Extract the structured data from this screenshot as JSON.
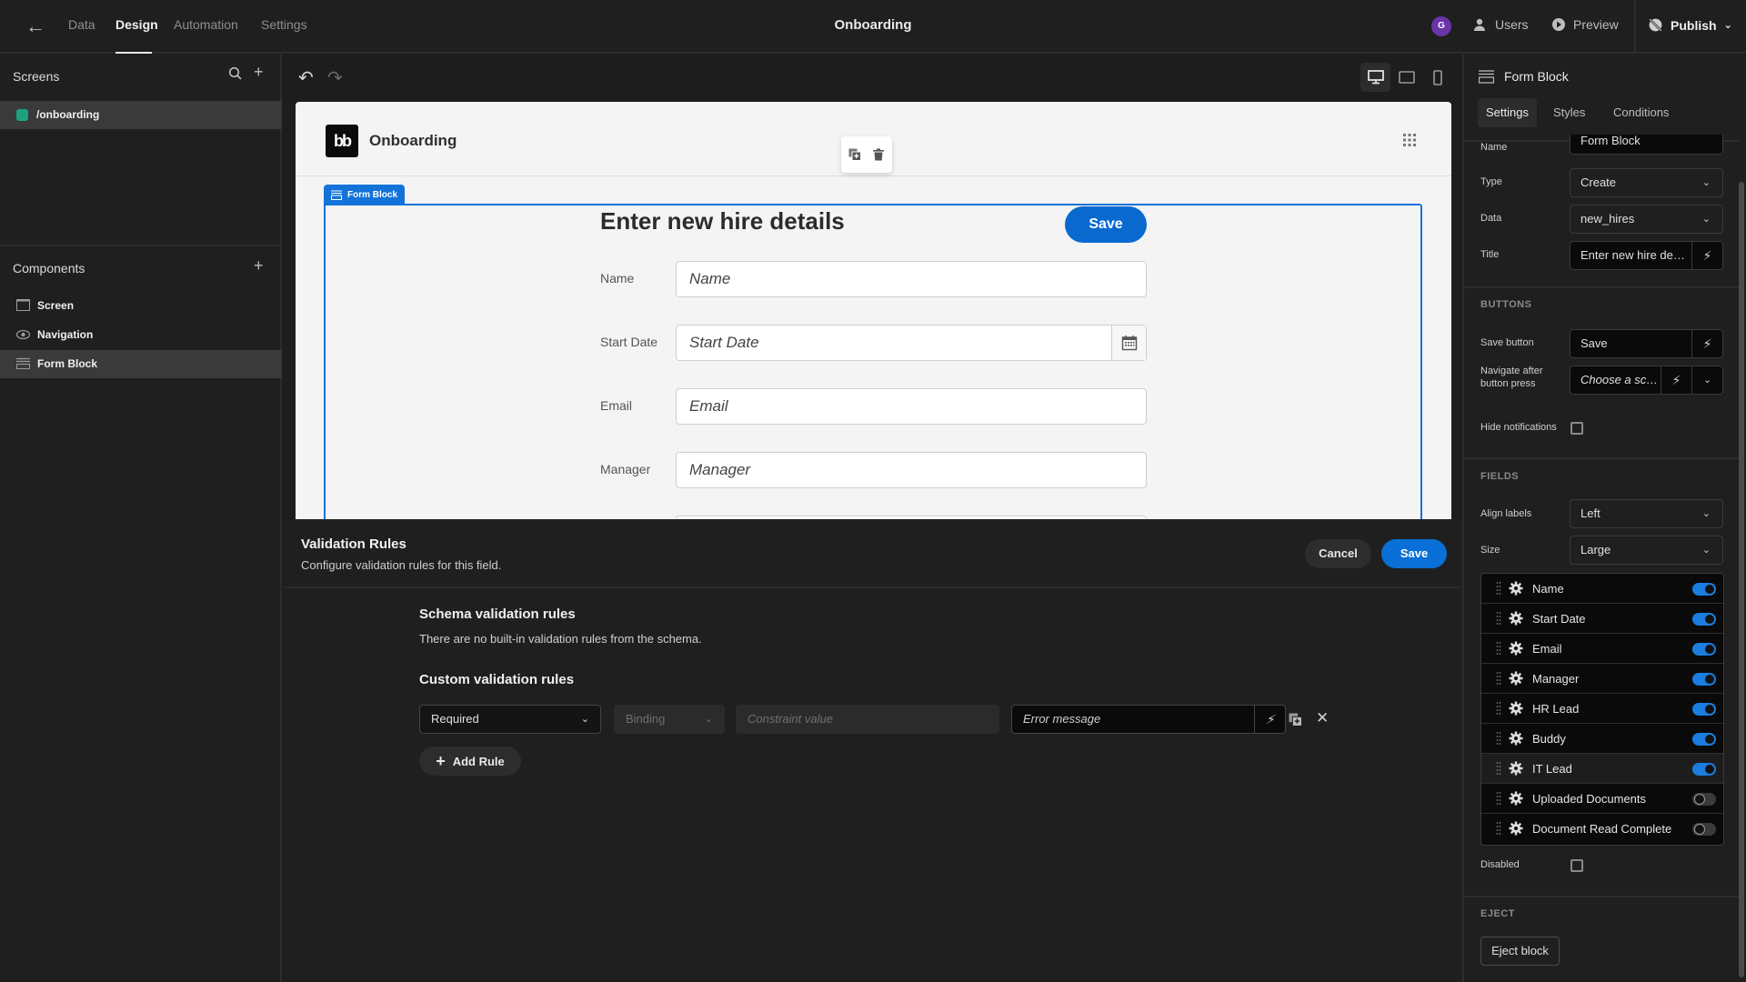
{
  "topbar": {
    "back_icon": "arrow-left-icon",
    "tabs": [
      {
        "label": "Data",
        "active": false
      },
      {
        "label": "Design",
        "active": true
      },
      {
        "label": "Automation",
        "active": false
      },
      {
        "label": "Settings",
        "active": false
      }
    ],
    "app_title": "Onboarding",
    "avatar_initial": "G",
    "users_label": "Users",
    "preview_label": "Preview",
    "publish_label": "Publish"
  },
  "sidebar": {
    "screens_heading": "Screens",
    "screens": [
      {
        "route": "/onboarding",
        "color": "#1aa37e",
        "selected": true
      }
    ],
    "components_heading": "Components",
    "components": [
      {
        "label": "Screen",
        "icon": "screen-icon",
        "selected": false
      },
      {
        "label": "Navigation",
        "icon": "eye-icon",
        "selected": false
      },
      {
        "label": "Form Block",
        "icon": "form-block-icon",
        "selected": true
      }
    ]
  },
  "canvas": {
    "device_modes": [
      "desktop",
      "tablet",
      "mobile"
    ],
    "active_device": "desktop",
    "app_name": "Onboarding",
    "logo_text": "bb",
    "component_tag": "Form Block",
    "form_title": "Enter new hire details",
    "save_label": "Save",
    "fields": [
      {
        "label": "Name",
        "placeholder": "Name"
      },
      {
        "label": "Start Date",
        "placeholder": "Start Date",
        "has_calendar": true
      },
      {
        "label": "Email",
        "placeholder": "Email"
      },
      {
        "label": "Manager",
        "placeholder": "Manager"
      }
    ]
  },
  "validation": {
    "title": "Validation Rules",
    "subtitle": "Configure validation rules for this field.",
    "cancel_label": "Cancel",
    "save_label": "Save",
    "schema_heading": "Schema validation rules",
    "schema_text": "There are no built-in validation rules from the schema.",
    "custom_heading": "Custom validation rules",
    "rule": {
      "type_value": "Required",
      "binding_placeholder": "Binding",
      "constraint_placeholder": "Constraint value",
      "error_placeholder": "Error message"
    },
    "add_rule_label": "Add Rule"
  },
  "settings_panel": {
    "component_name": "Form Block",
    "tabs": [
      {
        "label": "Settings",
        "active": true
      },
      {
        "label": "Styles",
        "active": false
      },
      {
        "label": "Conditions",
        "active": false
      }
    ],
    "name_label": "Name",
    "name_value": "Form Block",
    "type_label": "Type",
    "type_value": "Create",
    "data_label": "Data",
    "data_value": "new_hires",
    "title_label": "Title",
    "title_value": "Enter new hire de…",
    "buttons_section": "BUTTONS",
    "save_button_label": "Save button",
    "save_button_value": "Save",
    "navigate_label": "Navigate after button press",
    "navigate_placeholder": "Choose a sc…",
    "hide_notifications_label": "Hide notifications",
    "hide_notifications_checked": false,
    "fields_section": "FIELDS",
    "align_labels_label": "Align labels",
    "align_labels_value": "Left",
    "size_label": "Size",
    "size_value": "Large",
    "field_list": [
      {
        "name": "Name",
        "enabled": true
      },
      {
        "name": "Start Date",
        "enabled": true
      },
      {
        "name": "Email",
        "enabled": true
      },
      {
        "name": "Manager",
        "enabled": true
      },
      {
        "name": "HR Lead",
        "enabled": true
      },
      {
        "name": "Buddy",
        "enabled": true
      },
      {
        "name": "IT Lead",
        "enabled": true
      },
      {
        "name": "Uploaded Documents",
        "enabled": false
      },
      {
        "name": "Document Read Complete",
        "enabled": false
      }
    ],
    "disabled_label": "Disabled",
    "disabled_checked": false,
    "eject_section": "EJECT",
    "eject_label": "Eject block"
  },
  "colors": {
    "accent": "#0a6fd6",
    "selection": "#1473d9",
    "screen_dot": "#1aa37e",
    "avatar": "#6b34a8"
  }
}
